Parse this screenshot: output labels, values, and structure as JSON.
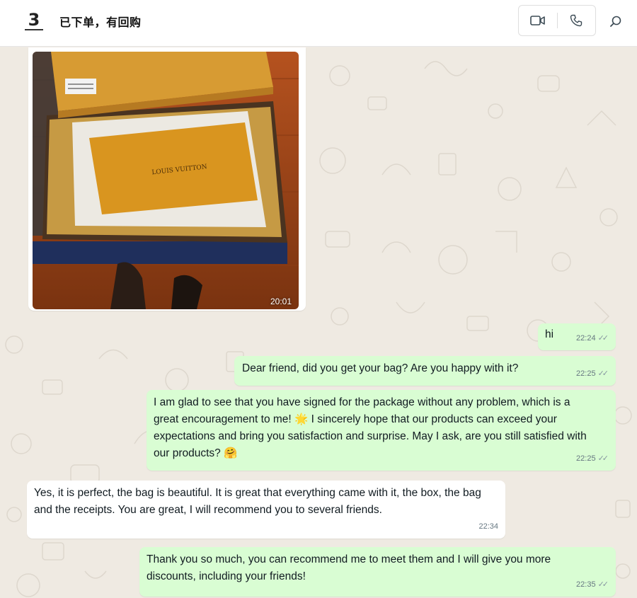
{
  "header": {
    "avatar_glyph": "3",
    "title": "已下单，有回购",
    "icons": [
      "video-call-icon",
      "voice-call-icon",
      "search-icon"
    ]
  },
  "image_message": {
    "time": "20:01",
    "photo_label": "LOUIS VUITTON"
  },
  "messages": [
    {
      "direction": "out",
      "text": "hi",
      "time": "22:24",
      "status": "read"
    },
    {
      "direction": "out",
      "text": "Dear friend, did you get your bag? Are you happy with it?",
      "time": "22:25",
      "status": "read"
    },
    {
      "direction": "out",
      "text": "I am glad to see that you have signed for the package without any problem, which is a great encouragement to me! 🌟 I sincerely hope that our products can exceed your expectations and bring you satisfaction and surprise. May I ask, are you still satisfied with our products? 🤗",
      "time": "22:25",
      "status": "read"
    },
    {
      "direction": "in",
      "text": "Yes, it is perfect, the bag is beautiful. It is great that everything came with it, the box, the bag and the receipts. You are great, I will recommend you to several friends.",
      "time": "22:34"
    },
    {
      "direction": "out",
      "text": "Thank you so much, you can recommend me to meet them and I will give you more discounts, including your friends!",
      "time": "22:35",
      "status": "read"
    }
  ],
  "colors": {
    "outgoing_bubble": "#d9fdd3",
    "incoming_bubble": "#ffffff",
    "chat_background": "#efeae2",
    "timestamp": "#667781"
  }
}
